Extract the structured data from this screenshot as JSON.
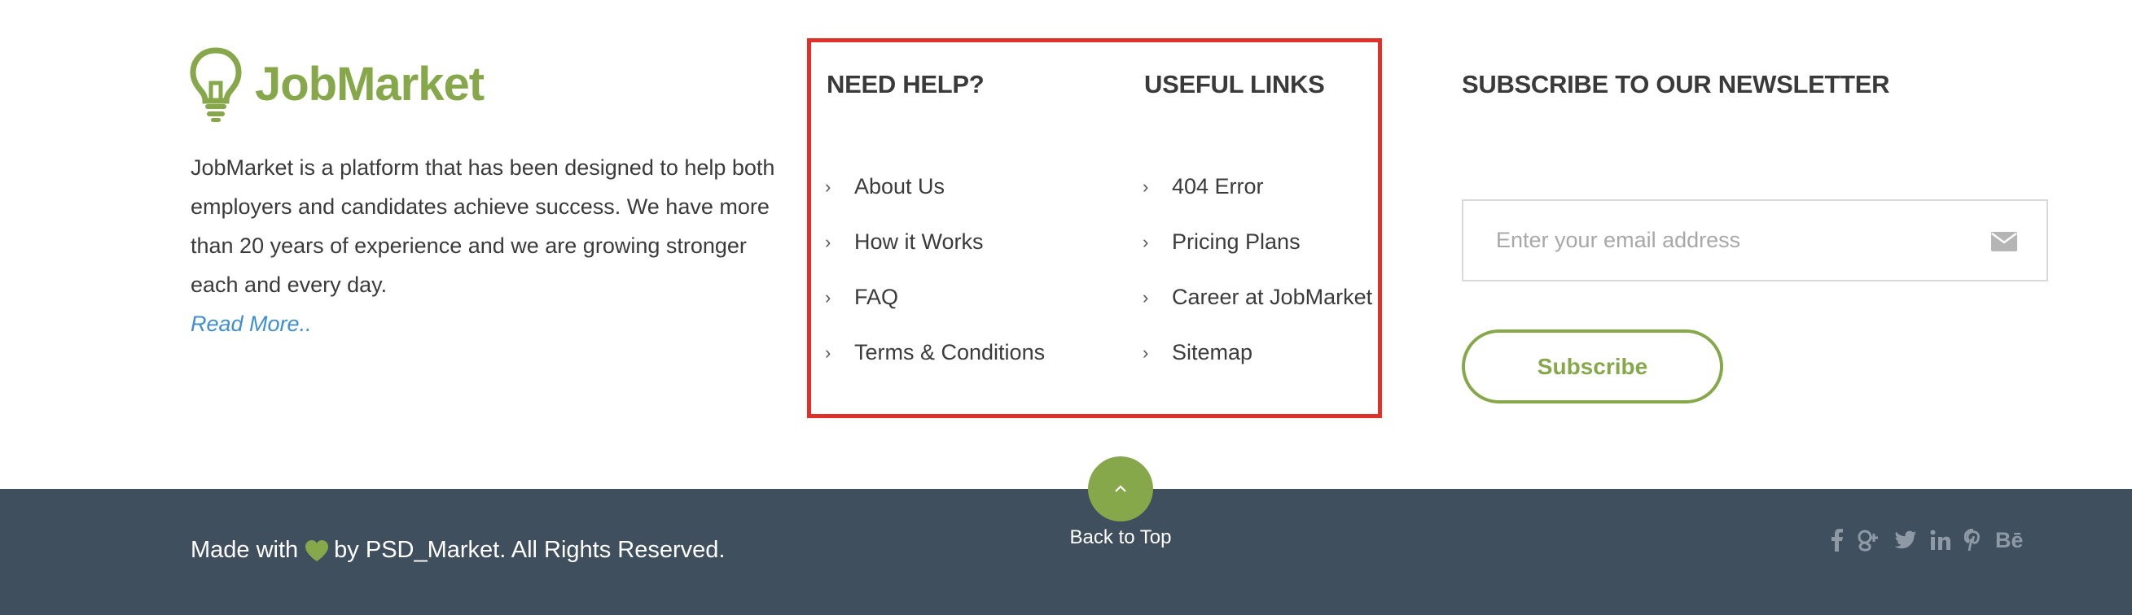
{
  "brand": {
    "name": "JobMarket",
    "color": "#86a84b"
  },
  "about": {
    "text": "JobMarket is a platform that has been designed to help both employers and candidates achieve success. We have more than 20 years of experience and we are growing stronger each and every day.",
    "read_more": "Read More.."
  },
  "need_help": {
    "title": "NEED HELP?",
    "items": [
      "About Us",
      "How it Works",
      "FAQ",
      "Terms & Conditions"
    ]
  },
  "useful_links": {
    "title": "USEFUL LINKS",
    "items": [
      "404 Error",
      "Pricing Plans",
      "Career at JobMarket",
      "Sitemap"
    ]
  },
  "newsletter": {
    "title": "SUBSCRIBE TO OUR NEWSLETTER",
    "placeholder": "Enter your email address",
    "button": "Subscribe"
  },
  "bottom": {
    "made_with": "Made with",
    "by_text": "by PSD_Market. All Rights Reserved.",
    "back_to_top": "Back to Top",
    "social_icons": [
      "facebook-icon",
      "google-plus-icon",
      "twitter-icon",
      "linkedin-icon",
      "pinterest-icon",
      "behance-icon"
    ]
  },
  "colors": {
    "accent_green": "#86a84b",
    "link_blue": "#3f8fd0",
    "highlight_red": "#e0302a",
    "footer_bar": "#3f4f5d"
  }
}
